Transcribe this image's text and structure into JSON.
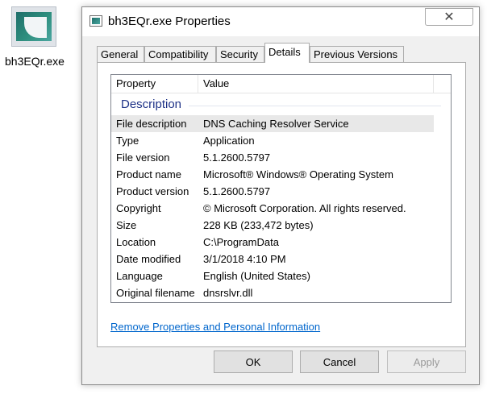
{
  "desktop": {
    "file_label": "bh3EQr.exe"
  },
  "window": {
    "title": "bh3EQr.exe Properties",
    "close_glyph": "✕"
  },
  "tabs": [
    {
      "label": "General"
    },
    {
      "label": "Compatibility"
    },
    {
      "label": "Security"
    },
    {
      "label": "Details",
      "active": true
    },
    {
      "label": "Previous Versions"
    }
  ],
  "details": {
    "header": {
      "property": "Property",
      "value": "Value"
    },
    "group": "Description",
    "rows": [
      {
        "property": "File description",
        "value": "DNS Caching Resolver Service"
      },
      {
        "property": "Type",
        "value": "Application"
      },
      {
        "property": "File version",
        "value": "5.1.2600.5797"
      },
      {
        "property": "Product name",
        "value": "Microsoft® Windows® Operating System"
      },
      {
        "property": "Product version",
        "value": "5.1.2600.5797"
      },
      {
        "property": "Copyright",
        "value": "© Microsoft Corporation. All rights reserved."
      },
      {
        "property": "Size",
        "value": "228 KB (233,472 bytes)"
      },
      {
        "property": "Location",
        "value": "C:\\ProgramData"
      },
      {
        "property": "Date modified",
        "value": "3/1/2018 4:10 PM"
      },
      {
        "property": "Language",
        "value": "English (United States)"
      },
      {
        "property": "Original filename",
        "value": "dnsrslvr.dll"
      }
    ],
    "remove_link": "Remove Properties and Personal Information"
  },
  "buttons": {
    "ok": "OK",
    "cancel": "Cancel",
    "apply": "Apply"
  }
}
